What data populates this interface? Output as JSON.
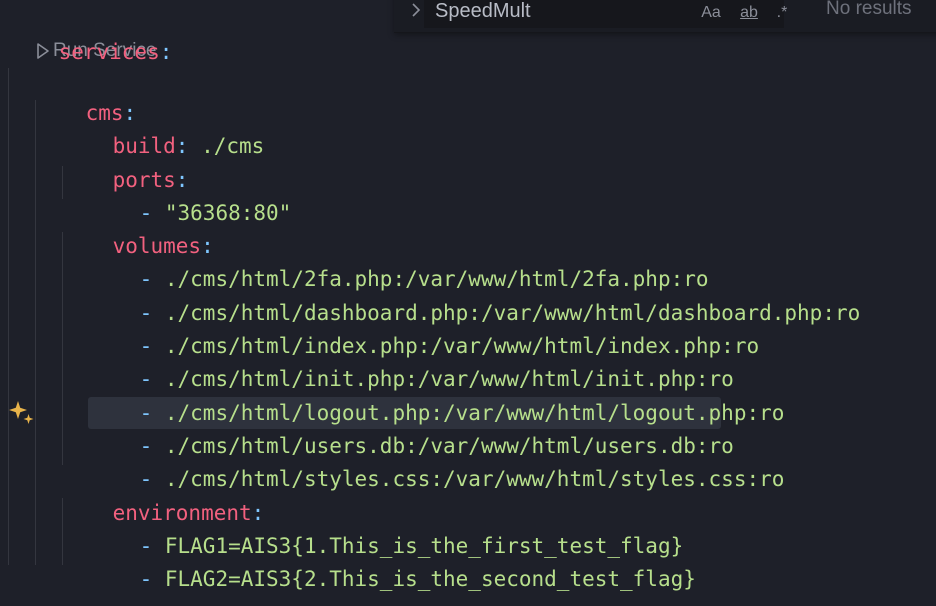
{
  "codelens": {
    "label": "Run Service"
  },
  "find": {
    "query": "SpeedMult",
    "options": {
      "match_case": "Aa",
      "whole_word": "ab",
      "regex": ".*"
    },
    "results": "No results"
  },
  "lines": [
    {
      "key": "services",
      "colon": ":"
    },
    {
      "key": "cms",
      "colon": ":"
    },
    {
      "key": "build",
      "colon": ":",
      "value": " ./cms"
    },
    {
      "key": "ports",
      "colon": ":"
    },
    {
      "dash": "- ",
      "value": "\"36368:80\""
    },
    {
      "key": "volumes",
      "colon": ":"
    },
    {
      "dash": "- ",
      "value": "./cms/html/2fa.php:/var/www/html/2fa.php:ro"
    },
    {
      "dash": "- ",
      "value": "./cms/html/dashboard.php:/var/www/html/dashboard.php:ro"
    },
    {
      "dash": "- ",
      "value": "./cms/html/index.php:/var/www/html/index.php:ro"
    },
    {
      "dash": "- ",
      "value": "./cms/html/init.php:/var/www/html/init.php:ro"
    },
    {
      "dash": "- ",
      "value": "./cms/html/logout.php:/var/www/html/logout.php:ro"
    },
    {
      "dash": "- ",
      "value": "./cms/html/users.db:/var/www/html/users.db:ro"
    },
    {
      "dash": "- ",
      "value": "./cms/html/styles.css:/var/www/html/styles.css:ro"
    },
    {
      "key": "environment",
      "colon": ":"
    },
    {
      "dash": "- ",
      "value": "FLAG1=AIS3{1.This_is_the_first_test_flag}"
    },
    {
      "dash": "- ",
      "value": "FLAG2=AIS3{2.This_is_the_second_test_flag}"
    }
  ]
}
